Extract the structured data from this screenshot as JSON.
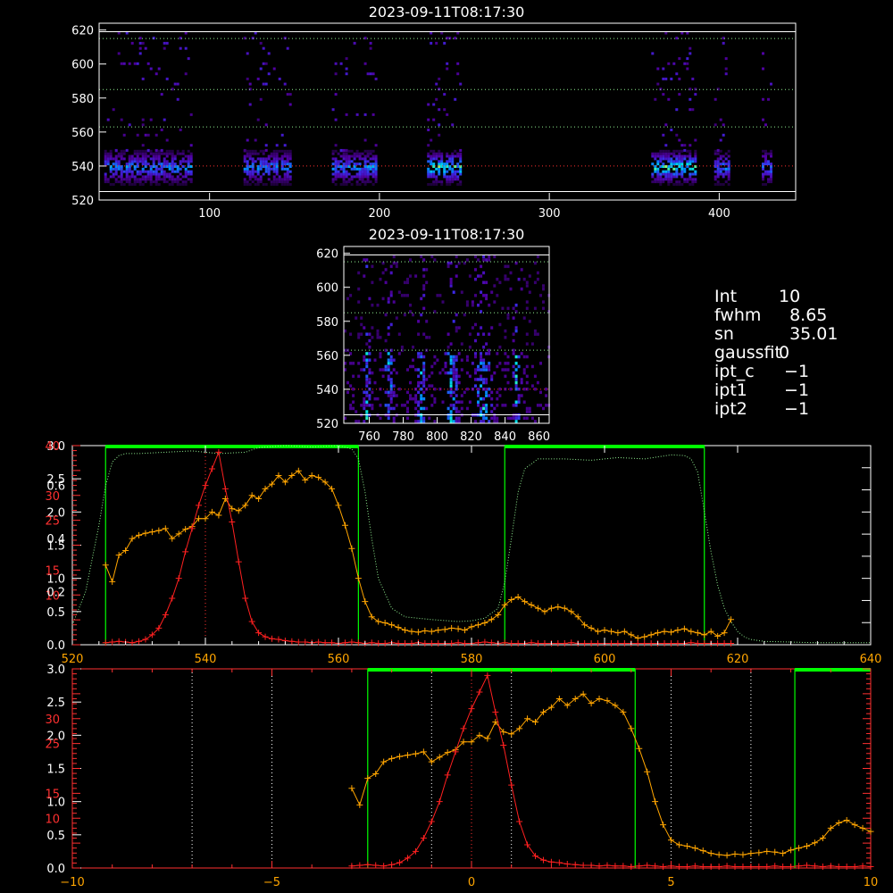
{
  "colors": {
    "background": "#000000",
    "axis": "#ffffff",
    "green": "#00ff00",
    "orange": "#ffa500",
    "red": "#ff2020",
    "dotted_green": "#90ee90"
  },
  "info": [
    {
      "key": "Int",
      "value": "10"
    },
    {
      "key": "fwhm",
      "value": "  8.65"
    },
    {
      "key": "sn",
      "value": "  35.01"
    },
    {
      "key": "gaussfit",
      "value": "0"
    },
    {
      "key": "ipt_c",
      "value": " −1"
    },
    {
      "key": "ipt1",
      "value": " −1"
    },
    {
      "key": "ipt2",
      "value": " −1"
    }
  ],
  "chart_data": [
    {
      "type": "heatmap",
      "title": "2023-09-11T08:17:30",
      "xlim": [
        35,
        445
      ],
      "ylim": [
        520,
        624
      ],
      "x_ticks": [
        "100",
        "200",
        "300",
        "400"
      ],
      "y_ticks": [
        "520",
        "540",
        "560",
        "580",
        "600",
        "620"
      ],
      "hlines": [
        525,
        540,
        563,
        585,
        615
      ],
      "bands": [
        [
          38,
          90
        ],
        [
          120,
          148
        ],
        [
          172,
          198
        ],
        [
          228,
          248
        ],
        [
          360,
          386
        ],
        [
          397,
          406
        ],
        [
          425,
          430
        ]
      ]
    },
    {
      "type": "heatmap",
      "title": "2023-09-11T08:17:30",
      "xlim": [
        745,
        866
      ],
      "ylim": [
        520,
        624
      ],
      "x_ticks": [
        "760",
        "780",
        "800",
        "820",
        "840",
        "860"
      ],
      "y_ticks": [
        "520",
        "540",
        "560",
        "580",
        "600",
        "620"
      ],
      "hlines": [
        525,
        540,
        563,
        585,
        615
      ],
      "streaks": [
        [
          758,
          3
        ],
        [
          771,
          4
        ],
        [
          790,
          4
        ],
        [
          808,
          5
        ],
        [
          826,
          8
        ],
        [
          846,
          4
        ]
      ]
    },
    {
      "type": "line",
      "xlim": [
        520,
        640
      ],
      "x_ticks": [
        "520",
        "540",
        "560",
        "580",
        "600",
        "620",
        "640"
      ],
      "y_left_white": [
        "0.0",
        "0.5",
        "1.0",
        "1.5",
        "2.0",
        "2.5",
        "3.0"
      ],
      "y_left_white_max": 3.0,
      "y_left_red": [
        "10",
        "15",
        "25",
        "30",
        "40"
      ],
      "y_left_overlay": [
        "0.2",
        "0.4",
        "0.6"
      ],
      "y_right_ticks": 9,
      "green_windows": [
        [
          525,
          563
        ],
        [
          585,
          615
        ]
      ],
      "vline_red": 540,
      "series": [
        {
          "color": "orange",
          "x": [
            525,
            526,
            527,
            528,
            529,
            530,
            531,
            532,
            533,
            534,
            535,
            536,
            537,
            538,
            539,
            540,
            541,
            542,
            543,
            544,
            545,
            546,
            547,
            548,
            549,
            550,
            551,
            552,
            553,
            554,
            555,
            556,
            557,
            558,
            559,
            560,
            561,
            562,
            563,
            564,
            565,
            566,
            567,
            568,
            569,
            570,
            571,
            572,
            573,
            574,
            575,
            576,
            577,
            578,
            579,
            580,
            581,
            582,
            583,
            584,
            585,
            586,
            587,
            588,
            589,
            590,
            591,
            592,
            593,
            594,
            595,
            596,
            597,
            598,
            599,
            600,
            601,
            602,
            603,
            604,
            605,
            606,
            607,
            608,
            609,
            610,
            611,
            612,
            613,
            614,
            615,
            616,
            617,
            618,
            619
          ],
          "y": [
            1.2,
            0.95,
            1.35,
            1.42,
            1.6,
            1.65,
            1.68,
            1.7,
            1.72,
            1.75,
            1.6,
            1.67,
            1.74,
            1.78,
            1.9,
            1.9,
            2.0,
            1.95,
            2.2,
            2.05,
            2.02,
            2.1,
            2.25,
            2.2,
            2.35,
            2.42,
            2.55,
            2.45,
            2.55,
            2.62,
            2.48,
            2.55,
            2.52,
            2.45,
            2.35,
            2.1,
            1.8,
            1.45,
            1.0,
            0.65,
            0.42,
            0.35,
            0.33,
            0.3,
            0.26,
            0.22,
            0.2,
            0.19,
            0.21,
            0.2,
            0.22,
            0.23,
            0.25,
            0.24,
            0.22,
            0.27,
            0.3,
            0.33,
            0.38,
            0.45,
            0.6,
            0.68,
            0.72,
            0.65,
            0.6,
            0.55,
            0.5,
            0.55,
            0.57,
            0.55,
            0.5,
            0.42,
            0.3,
            0.25,
            0.2,
            0.22,
            0.2,
            0.18,
            0.2,
            0.15,
            0.1,
            0.12,
            0.15,
            0.18,
            0.2,
            0.19,
            0.22,
            0.24,
            0.2,
            0.18,
            0.15,
            0.2,
            0.13,
            0.18,
            0.38
          ]
        },
        {
          "color": "red",
          "x": [
            525,
            526,
            527,
            528,
            529,
            530,
            531,
            532,
            533,
            534,
            535,
            536,
            537,
            538,
            539,
            540,
            541,
            542,
            543,
            544,
            545,
            546,
            547,
            548,
            549,
            550,
            551,
            552,
            553,
            554,
            555,
            556,
            557,
            558,
            559,
            560,
            561,
            562,
            563,
            564,
            565,
            566,
            567,
            568,
            569,
            570,
            571,
            572,
            573,
            574,
            575,
            576,
            577,
            578,
            579,
            580,
            581,
            582,
            583,
            584,
            585,
            586,
            587,
            588,
            589,
            590,
            591,
            592,
            593,
            594,
            595,
            596,
            597,
            598,
            599,
            600,
            601,
            602,
            603,
            604,
            605,
            606,
            607,
            608,
            609,
            610,
            611,
            612,
            613,
            614,
            615,
            616,
            617,
            618,
            619
          ],
          "y": [
            0.03,
            0.04,
            0.05,
            0.04,
            0.03,
            0.05,
            0.08,
            0.15,
            0.25,
            0.45,
            0.7,
            1.0,
            1.4,
            1.75,
            2.1,
            2.4,
            2.65,
            2.9,
            2.35,
            1.85,
            1.25,
            0.7,
            0.35,
            0.18,
            0.12,
            0.09,
            0.08,
            0.06,
            0.05,
            0.04,
            0.04,
            0.03,
            0.04,
            0.03,
            0.03,
            0.02,
            0.03,
            0.04,
            0.03,
            0.02,
            0.03,
            0.02,
            0.02,
            0.03,
            0.02,
            0.02,
            0.02,
            0.03,
            0.02,
            0.02,
            0.02,
            0.02,
            0.02,
            0.03,
            0.02,
            0.02,
            0.03,
            0.04,
            0.03,
            0.02,
            0.03,
            0.02,
            0.02,
            0.02,
            0.03,
            0.02,
            0.02,
            0.02,
            0.02,
            0.02,
            0.03,
            0.02,
            0.02,
            0.02,
            0.02,
            0.02,
            0.02,
            0.02,
            0.02,
            0.02,
            0.02,
            0.02,
            0.02,
            0.02,
            0.02,
            0.02,
            0.02,
            0.02,
            0.03,
            0.02,
            0.02,
            0.02,
            0.02,
            0.02,
            0.02
          ]
        },
        {
          "color": "dotted_green",
          "x": [
            520,
            522,
            524,
            525,
            526,
            527,
            528,
            530,
            534,
            538,
            542,
            546,
            548,
            552,
            556,
            560,
            562,
            563,
            564,
            565,
            566,
            568,
            570,
            574,
            578,
            580,
            582,
            584,
            585,
            586,
            587,
            588,
            590,
            594,
            598,
            602,
            606,
            610,
            612,
            613,
            614,
            615,
            616,
            617,
            618,
            619,
            620,
            621,
            622,
            624,
            628,
            632,
            636,
            640
          ],
          "y": [
            0.3,
            0.8,
            1.8,
            2.4,
            2.75,
            2.85,
            2.88,
            2.88,
            2.9,
            2.92,
            2.88,
            2.9,
            2.97,
            3.0,
            2.98,
            3.0,
            2.95,
            2.8,
            2.3,
            1.6,
            1.0,
            0.55,
            0.42,
            0.38,
            0.35,
            0.36,
            0.4,
            0.55,
            0.95,
            1.6,
            2.3,
            2.65,
            2.8,
            2.8,
            2.78,
            2.82,
            2.8,
            2.86,
            2.85,
            2.8,
            2.6,
            2.0,
            1.4,
            0.9,
            0.55,
            0.35,
            0.2,
            0.12,
            0.08,
            0.05,
            0.04,
            0.03,
            0.03,
            0.03
          ]
        }
      ]
    },
    {
      "type": "line",
      "xlim": [
        -10,
        10
      ],
      "x_ticks": [
        "−10",
        "−5",
        "0",
        "5",
        "10"
      ],
      "x_tick_values": [
        -10,
        -5,
        0,
        5,
        10
      ],
      "y_left_white": [
        "0.0",
        "0.5",
        "1.0",
        "1.5",
        "2.0",
        "2.5",
        "3.0"
      ],
      "y_left_white_max": 3.0,
      "y_left_red": [
        "10",
        "15",
        "25",
        "30"
      ],
      "green_windows": [
        [
          -2.6,
          4.1
        ],
        [
          8.1,
          10
        ]
      ],
      "vlines_dotted": [
        -7,
        -5,
        -1,
        1,
        5,
        7
      ],
      "vline_red": 0,
      "x_offset": 540,
      "x_scale": 0.2
    }
  ]
}
